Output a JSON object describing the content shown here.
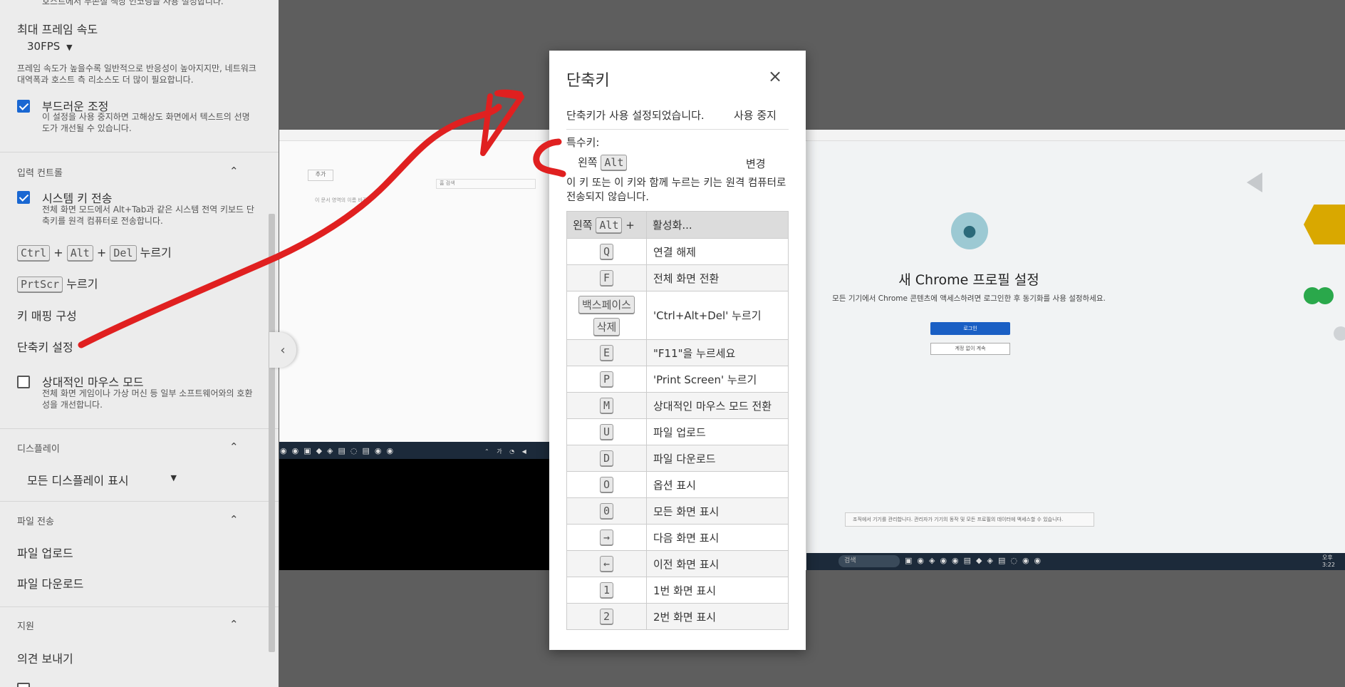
{
  "sidebar": {
    "top_cut_text": "호스트에서 무손실 색상 인코딩을 사용 설정합니다.",
    "max_fps_title": "최대 프레임 속도",
    "max_fps_value": "30FPS",
    "max_fps_desc": "프레임 속도가 높을수록 일반적으로 반응성이 높아지지만, 네트워크 대역폭과 호스트 측 리소스도 더 많이 필요합니다.",
    "smooth_label": "부드러운 조정",
    "smooth_desc": "이 설정을 사용 중지하면 고해상도 화면에서 텍스트의 선명도가 개선될 수 있습니다.",
    "input_section": "입력 컨트롤",
    "system_keys_label": "시스템 키 전송",
    "system_keys_desc": "전체 화면 모드에서 Alt+Tab과 같은 시스템 전역 키보드 단축키를 원격 컴퓨터로 전송합니다.",
    "cad_keys": [
      "Ctrl",
      "Alt",
      "Del"
    ],
    "plus": "+",
    "press": "누르기",
    "prtscr_key": "PrtScr",
    "key_mapping": "키 매핑 구성",
    "shortcut_settings": "단축키 설정",
    "relative_mouse_label": "상대적인 마우스 모드",
    "relative_mouse_desc": "전체 화면 게임이나 가상 머신 등 일부 소프트웨어와의 호환성을 개선합니다.",
    "display_section": "디스플레이",
    "display_select": "모든 디스플레이 표시",
    "file_section": "파일 전송",
    "file_upload": "파일 업로드",
    "file_download": "파일 다운로드",
    "support_section": "지원",
    "feedback": "의견 보내기"
  },
  "dialog": {
    "title": "단축키",
    "close_icon": "×",
    "enabled_text": "단축키가 사용 설정되었습니다.",
    "disable_button": "사용 중지",
    "modifier_label": "특수키:",
    "modifier_prefix": "왼쪽",
    "modifier_key": "Alt",
    "change_button": "변경",
    "note": "이 키 또는 이 키와 함께 누르는 키는 원격 컴퓨터로 전송되지 않습니다.",
    "header_prefix": "왼쪽",
    "header_key": "Alt",
    "header_plus": "+",
    "header_action": "활성화...",
    "rows": [
      {
        "key": "Q",
        "action": "연결 해제"
      },
      {
        "key": "F",
        "action": "전체 화면 전환"
      },
      {
        "key": "백스페이스",
        "key2": "삭제",
        "action": "'Ctrl+Alt+Del' 누르기"
      },
      {
        "key": "E",
        "action": "\"F11\"을 누르세요"
      },
      {
        "key": "P",
        "action": "'Print Screen' 누르기"
      },
      {
        "key": "M",
        "action": "상대적인 마우스 모드 전환"
      },
      {
        "key": "U",
        "action": "파일 업로드"
      },
      {
        "key": "D",
        "action": "파일 다운로드"
      },
      {
        "key": "O",
        "action": "옵션 표시"
      },
      {
        "key": "0",
        "action": "모든 화면 표시"
      },
      {
        "key": "→",
        "action": "다음 화면 표시"
      },
      {
        "key": "←",
        "action": "이전 화면 표시"
      },
      {
        "key": "1",
        "action": "1번 화면 표시"
      },
      {
        "key": "2",
        "action": "2번 화면 표시"
      }
    ]
  },
  "remote": {
    "chrome_title": "새 Chrome 프로필 설정",
    "chrome_sub": "모든 기기에서 Chrome 콘텐츠에 액세스하려면 로그인한 후 동기화를 사용 설정하세요.",
    "login_button": "로그인",
    "no_account_button": "계정 없이 계속",
    "notice": "조직에서 기기를 관리합니다. 관리자가 기기의 동작 및 모든 프로필의 데이터에 액세스할 수 있습니다.",
    "search_placeholder": "검색",
    "left_tab": "추가",
    "left_addr": "홈 검색",
    "left_line": "이 문서 영역의 이름 바꾸기",
    "clock": "오후 3:22"
  },
  "colors": {
    "annotation": "#e02020",
    "checkbox": "#1967d2",
    "chrome_button": "#1a5fc4"
  },
  "icons": {
    "chevron_up": "chevron-up-icon",
    "dropdown": "dropdown-arrow-icon",
    "close": "close-icon",
    "collapse": "chevron-left-icon"
  }
}
